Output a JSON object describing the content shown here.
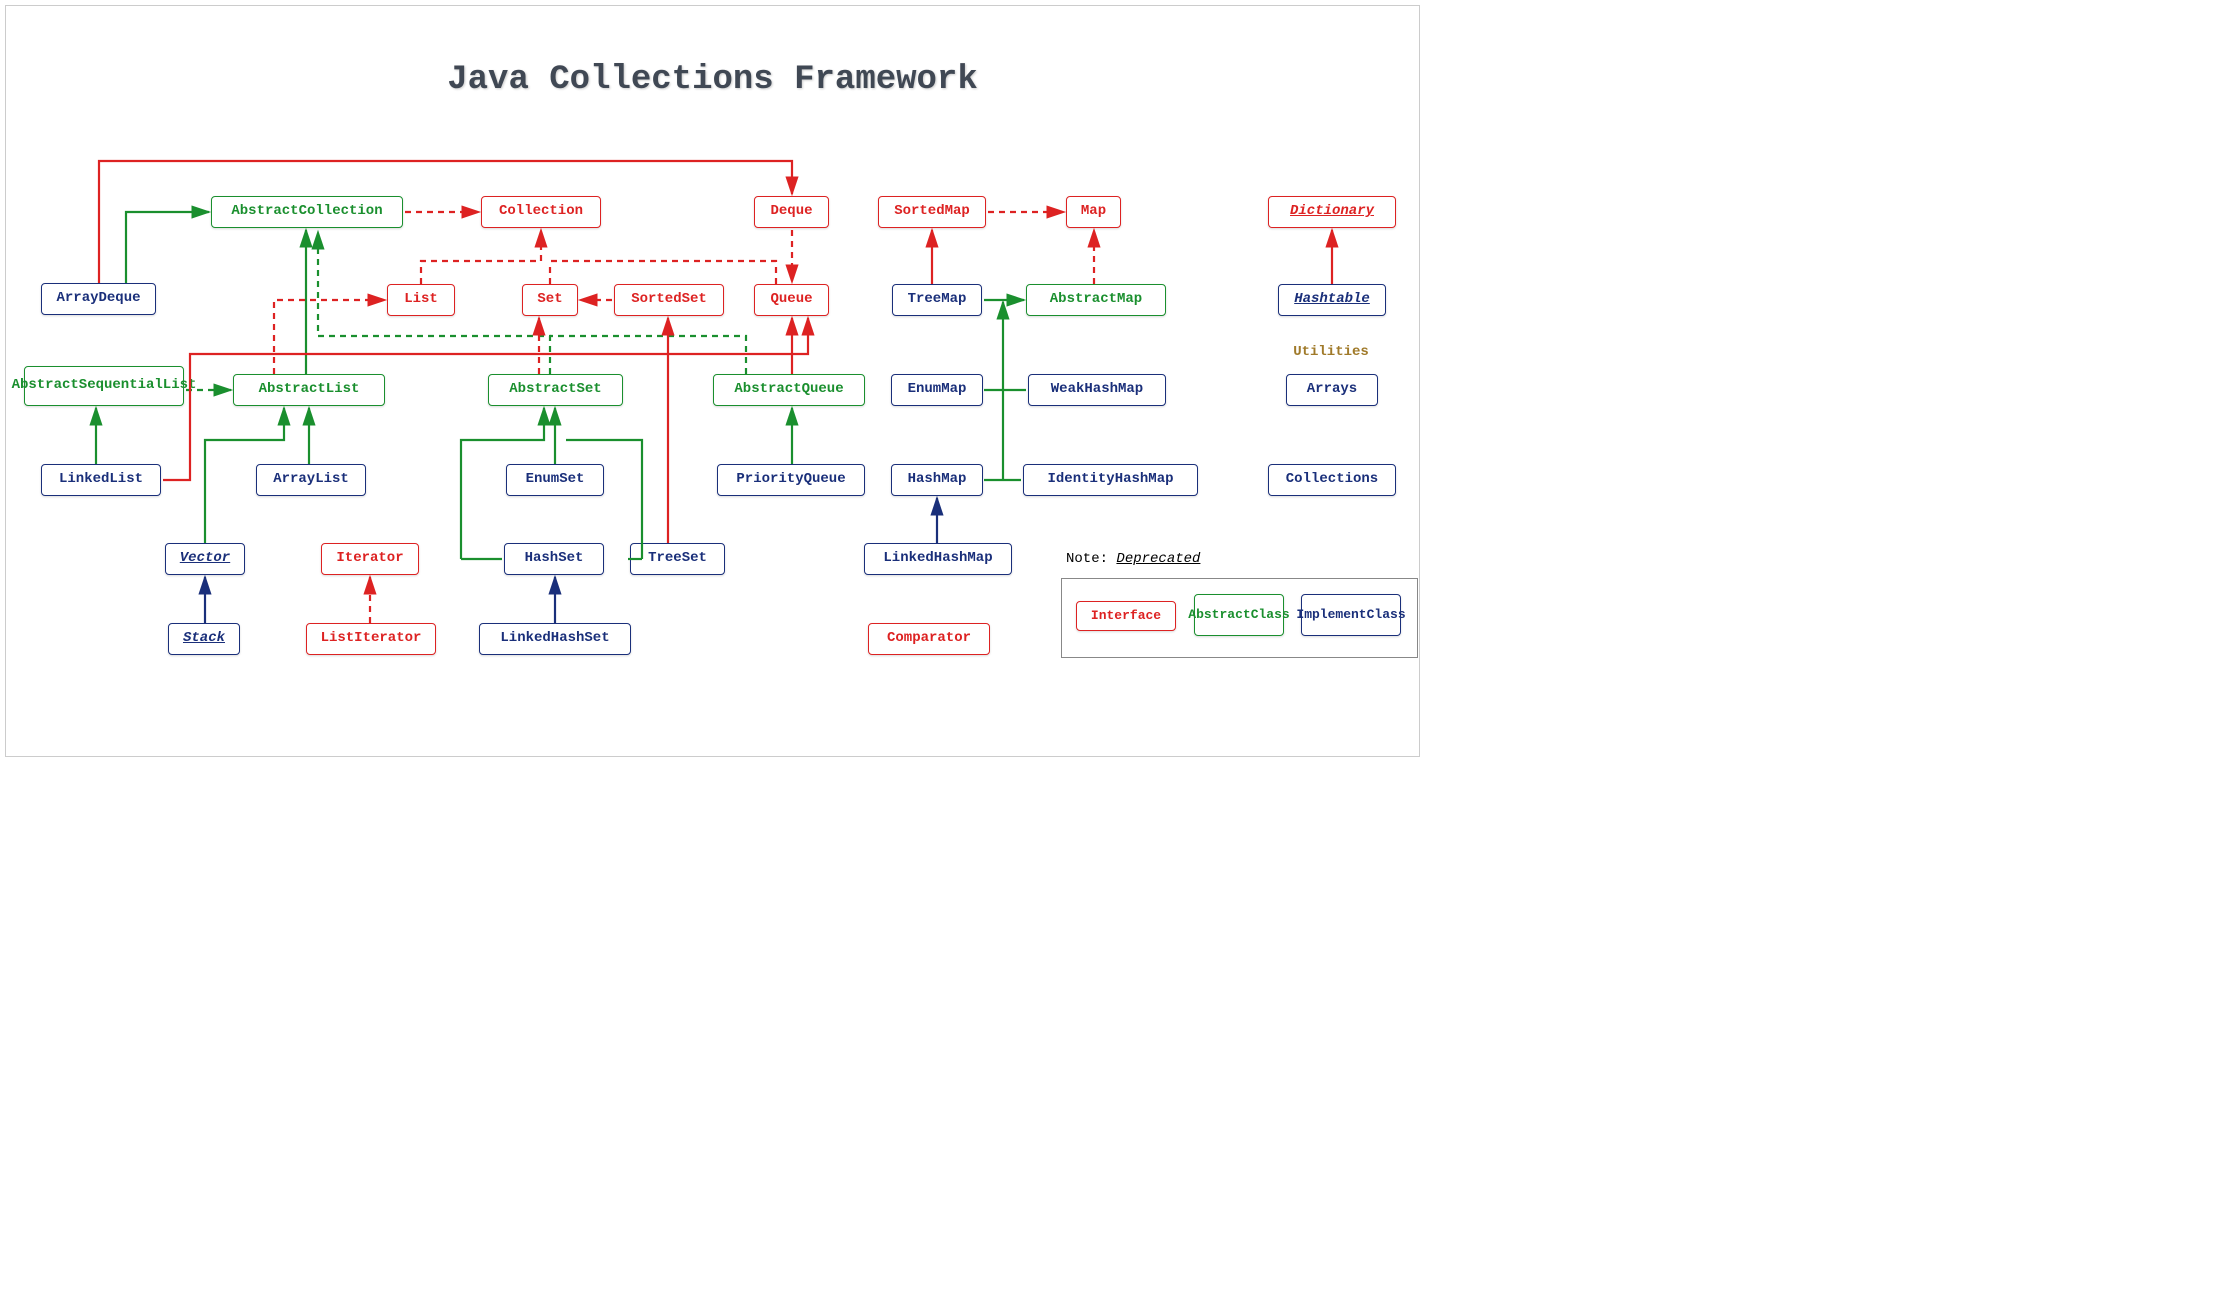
{
  "title": "Java Collections Framework",
  "nodes": {
    "abstractCollection": "AbstractCollection",
    "collection": "Collection",
    "deque": "Deque",
    "sortedMap": "SortedMap",
    "map": "Map",
    "dictionary": "Dictionary",
    "arrayDeque": "ArrayDeque",
    "list": "List",
    "set": "Set",
    "sortedSet": "SortedSet",
    "queue": "Queue",
    "treeMap": "TreeMap",
    "abstractMap": "AbstractMap",
    "hashtable": "Hashtable",
    "absSeqList1": "Abstract",
    "absSeqList2": "SequentialList",
    "abstractList": "AbstractList",
    "abstractSet": "AbstractSet",
    "abstractQueue": "AbstractQueue",
    "enumMap": "EnumMap",
    "weakHashMap": "WeakHashMap",
    "linkedList": "LinkedList",
    "arrayList": "ArrayList",
    "enumSet": "EnumSet",
    "priorityQueue": "PriorityQueue",
    "hashMap": "HashMap",
    "identityHashMap": "IdentityHashMap",
    "vector": "Vector",
    "iterator": "Iterator",
    "hashSet": "HashSet",
    "treeSet": "TreeSet",
    "linkedHashMap": "LinkedHashMap",
    "stack": "Stack",
    "listIterator": "ListIterator",
    "linkedHashSet": "LinkedHashSet",
    "comparator": "Comparator",
    "arrays": "Arrays",
    "collections": "Collections",
    "utilities": "Utilities"
  },
  "note": {
    "prefix": "Note: ",
    "deprecated": "Deprecated"
  },
  "legend": {
    "interface": "Interface",
    "abstract1": "Abstract",
    "abstract2": "Class",
    "implement1": "Implement",
    "implement2": "Class"
  }
}
